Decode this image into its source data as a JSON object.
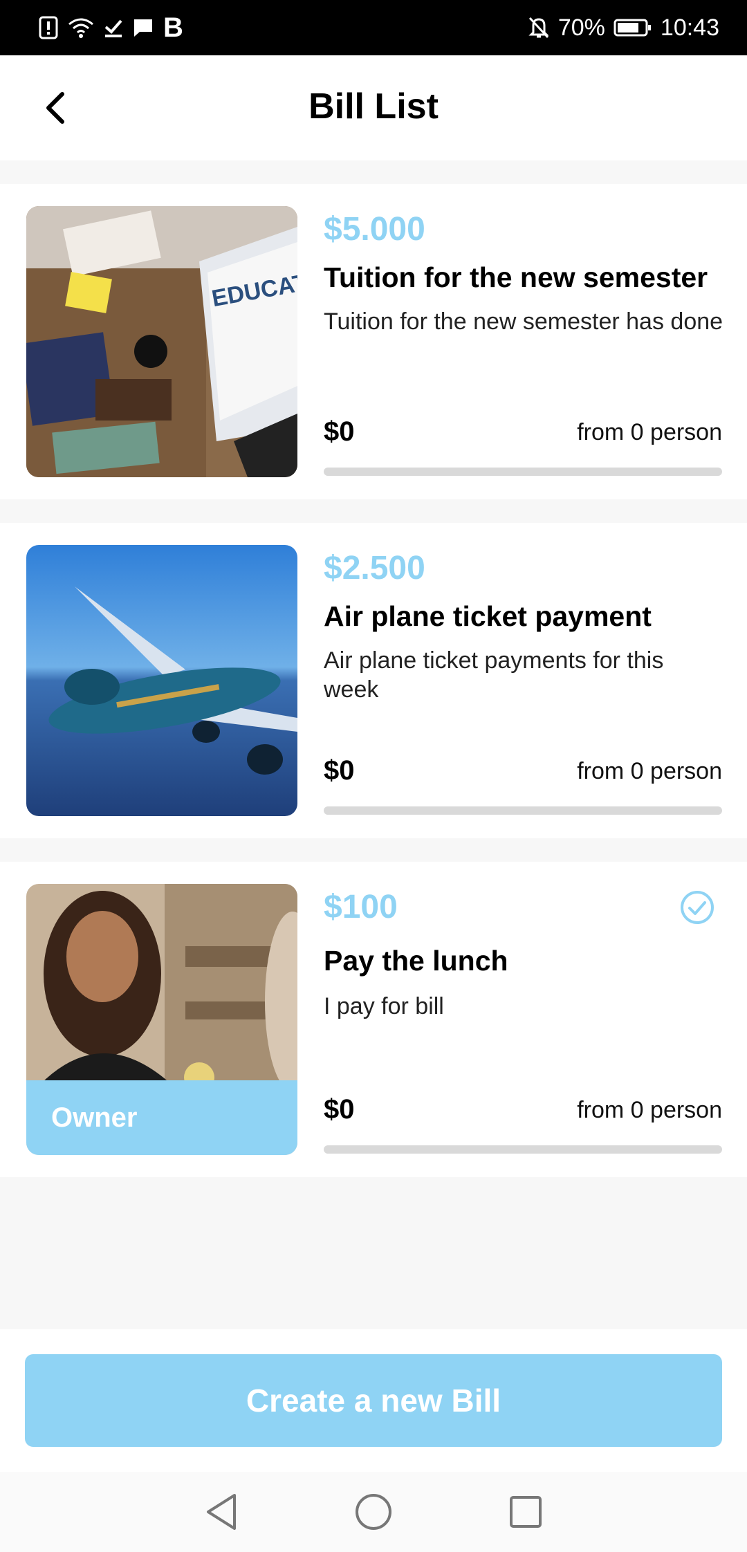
{
  "status_bar": {
    "battery": "70%",
    "time": "10:43",
    "letter_icon": "B"
  },
  "header": {
    "title": "Bill List",
    "back_icon": "chevron-left-icon"
  },
  "bills": [
    {
      "amount": "$5.000",
      "title": "Tuition for the new semester",
      "description": "Tuition for the new semester has done",
      "paid": "$0",
      "contributors": "from 0 person",
      "progress": 0,
      "image": "education-desk-photo"
    },
    {
      "amount": "$2.500",
      "title": "Air plane ticket payment",
      "description": "Air plane ticket payments for this week",
      "paid": "$0",
      "contributors": "from 0 person",
      "progress": 0,
      "image": "airplane-photo"
    },
    {
      "amount": "$100",
      "title": "Pay the lunch",
      "description": "I pay for bill",
      "paid": "$0",
      "contributors": "from 0 person",
      "progress": 0,
      "image": "lunch-photo",
      "badge": "Owner",
      "status_icon": "check-circle-icon"
    }
  ],
  "create_button": "Create a new Bill",
  "colors": {
    "accent": "#8fd3f4",
    "progress_track": "#d9d9d9"
  }
}
